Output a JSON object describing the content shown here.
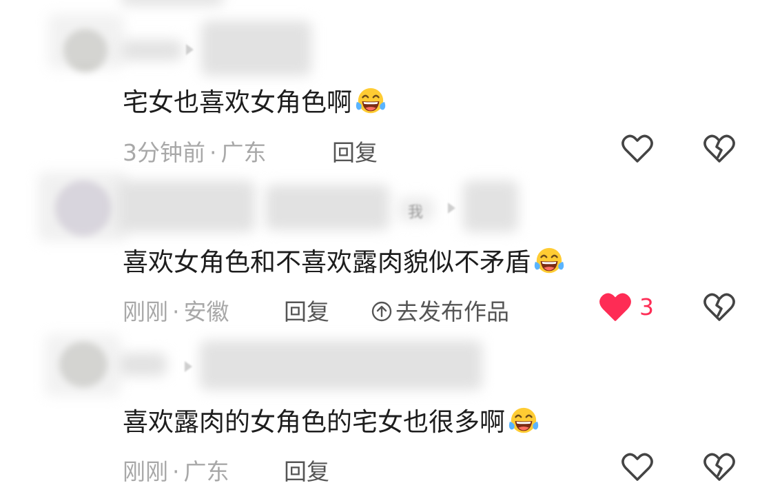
{
  "comments": [
    {
      "text": "宅女也喜欢女角色啊",
      "emoji": "tears-of-joy-emoji",
      "time": "3分钟前",
      "location": "广东",
      "reply_label": "回复",
      "liked": false,
      "like_count": ""
    },
    {
      "text": "喜欢女角色和不喜欢露肉貌似不矛盾",
      "emoji": "tears-of-joy-emoji",
      "time": "刚刚",
      "location": "安徽",
      "reply_label": "回复",
      "publish_label": "去发布作品",
      "liked": true,
      "like_count": "3",
      "blurred_tag": "我"
    },
    {
      "text": "喜欢露肉的女角色的宅女也很多啊",
      "emoji": "tears-of-joy-emoji",
      "time": "刚刚",
      "location": "广东",
      "reply_label": "回复",
      "liked": false,
      "like_count": ""
    }
  ],
  "separator": "·",
  "colors": {
    "like_active": "#fe2c55",
    "meta": "#a8a8a8",
    "text": "#1d1d1d"
  }
}
